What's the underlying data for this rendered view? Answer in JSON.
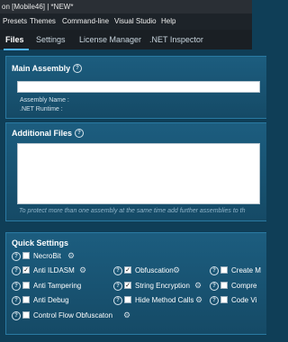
{
  "window": {
    "title": "on [Mobile46] | *NEW*"
  },
  "menu": {
    "items": [
      "Presets",
      "Themes",
      "Command-line",
      "Visual Studio",
      "Help"
    ]
  },
  "tabs": {
    "items": [
      "Files",
      "Settings",
      "License Manager",
      ".NET Inspector"
    ],
    "active": "Files"
  },
  "main_assembly": {
    "title": "Main Assembly",
    "input_value": "",
    "assembly_name_label": "Assembly Name  :",
    "net_runtime_label": ".NET Runtime    :"
  },
  "additional_files": {
    "title": "Additional Files",
    "note": "To protect more than one assembly at the same time add further assemblies to th"
  },
  "quick_settings": {
    "title": "Quick Settings",
    "options": {
      "necrobit": {
        "label": "NecroBit",
        "checked": false
      },
      "anti_ildasm": {
        "label": "Anti ILDASM",
        "checked": true
      },
      "obfuscation": {
        "label": "Obfuscation",
        "checked": true
      },
      "create_m": {
        "label": "Create M",
        "checked": false
      },
      "anti_tampering": {
        "label": "Anti Tampering",
        "checked": false
      },
      "string_encryption": {
        "label": "String Encryption",
        "checked": true
      },
      "compre": {
        "label": "Compre",
        "checked": false
      },
      "anti_debug": {
        "label": "Anti Debug",
        "checked": false
      },
      "hide_method_calls": {
        "label": "Hide Method Calls",
        "checked": false
      },
      "code_vi": {
        "label": "Code Vi",
        "checked": false
      },
      "control_flow": {
        "label": "Control Flow Obfuscaton",
        "checked": false
      }
    }
  },
  "icons": {
    "help": "?",
    "gear": "⚙",
    "check": "✓"
  }
}
